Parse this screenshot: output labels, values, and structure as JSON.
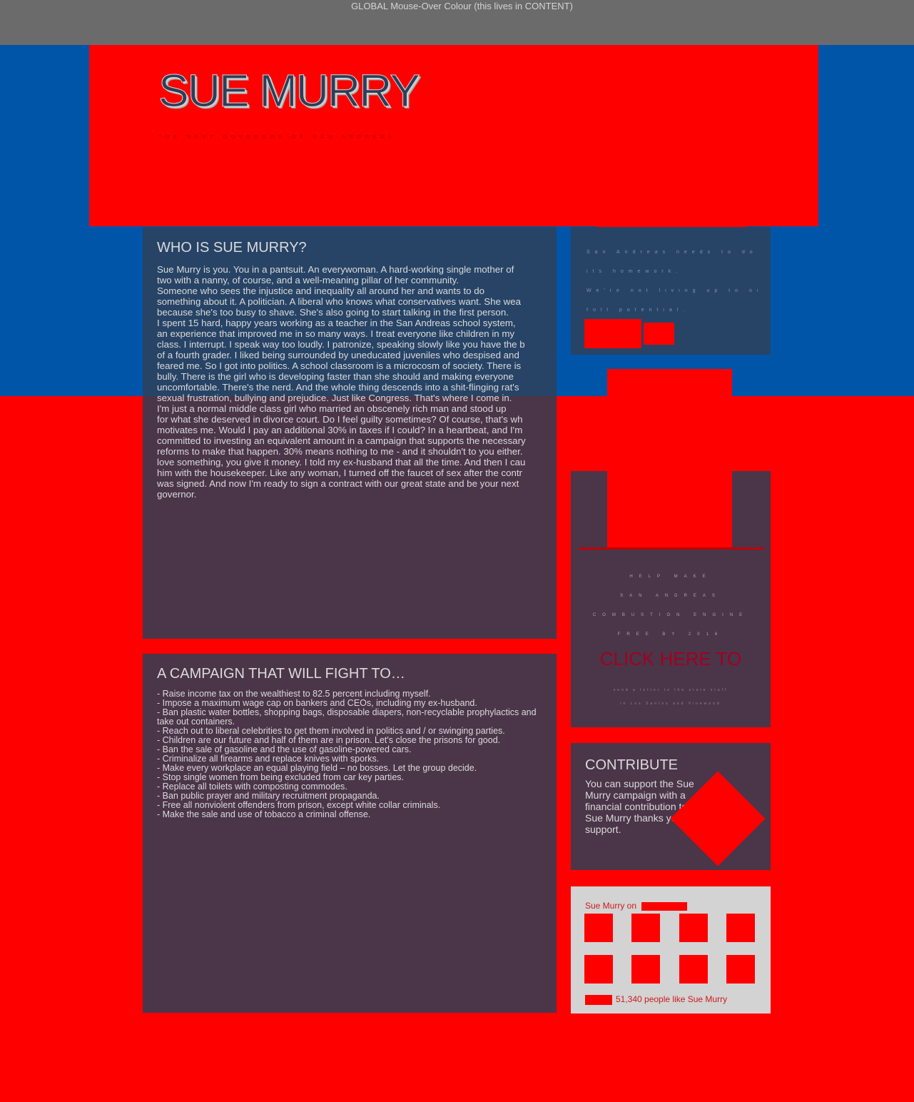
{
  "topbar": {
    "label": "GLOBAL Mouse-Over Colour (this lives in CONTENT)"
  },
  "header": {
    "title": "SUE MURRY",
    "tagline": "THE NEXT GOVERNOR OF SAN ANDREAS"
  },
  "who": {
    "title": "WHO IS SUE MURRY?",
    "lines": [
      "Sue Murry is you. You in a pantsuit. An everywoman. A hard-working single mother of",
      "two with a nanny, of course, and a well-meaning pillar of her community.",
      "Someone who sees the injustice and inequality all around her and wants to do",
      "something about it. A politician. A liberal who knows what conservatives want. She wea",
      "because she's too busy to shave. She's also going to start talking in the first person.",
      "I spent 15 hard, happy years working as a teacher in the San Andreas school system,",
      "an experience that improved me in so many ways. I treat everyone like children in my",
      "class. I interrupt. I speak way too loudly. I patronize, speaking slowly like you have the b",
      "of a fourth grader. I liked being surrounded by uneducated juveniles who despised and",
      "feared me. So I got into politics. A school classroom is a microcosm of society. There is",
      "bully. There is the girl who is developing faster than she should and making everyone",
      "uncomfortable. There's the nerd. And the whole thing descends into a shit-flinging rat's",
      "sexual frustration, bullying and prejudice. Just like Congress. That's where I come in.",
      "I'm just a normal middle class girl who married an obscenely rich man and stood up",
      "for what she deserved in divorce court. Do I feel guilty sometimes? Of course, that's wh",
      "motivates me. Would I pay an additional 30% in taxes if I could? In a heartbeat, and I'm",
      "committed to investing an equivalent amount in a campaign that supports the necessary",
      "reforms to make that happen. 30% means nothing to me - and it shouldn't to you either.",
      "love something, you give it money. I told my ex-husband that all the time. And then I cau",
      "him with the housekeeper. Like any woman, I turned off the faucet of sex after the contr",
      "was signed. And now I'm ready to sign a contract with our great state and be your next",
      "governor."
    ]
  },
  "campaign": {
    "title": "A CAMPAIGN THAT WILL FIGHT TO…",
    "items": [
      "- Raise income tax on the wealthiest to 82.5 percent including myself.",
      "- Impose a maximum wage cap on bankers and CEOs, including my ex-husband.",
      "- Ban plastic water bottles, shopping bags, disposable diapers, non-recyclable prophylactics and take out containers.",
      "- Reach out to liberal celebrities to get them involved in politics and / or swinging parties.",
      "- Children are our future and half of them are in prison. Let's close the prisons for good.",
      "- Ban the sale of gasoline and the use of gasoline-powered cars.",
      "- Criminalize all firearms and replace knives with sporks.",
      "- Make every workplace an equal playing field – no bosses. Let the group decide.",
      "- Stop single women from being excluded from car key parties.",
      "- Replace all toilets with composting commodes.",
      "- Ban public prayer and military recruitment propaganda.",
      "- Free all nonviolent offenders from prison, except white collar criminals.",
      "- Make the sale and use of tobacco a criminal offense."
    ]
  },
  "side1": {
    "lines": [
      "San Andreas needs to do",
      "its homework.",
      "We're not living up to our",
      "full potential."
    ]
  },
  "side2": {
    "lines": [
      "HELP MAKE",
      "SAN ANDREAS",
      "COMBUSTION ENGINE",
      "FREE BY 2016"
    ],
    "cta": "CLICK HERE TO",
    "small_lines": [
      "send a letter to the state staff",
      "in Los Santos and Vinewood"
    ]
  },
  "contribute": {
    "title": "CONTRIBUTE",
    "text": "You can support the Sue Murry campaign with a financial contribution to Sue Murry thanks you for support."
  },
  "social": {
    "label": "Sue Murry on",
    "like_count": "51,340 people like Sue Murry"
  },
  "colors": {
    "page_red": "#ff0000",
    "band_blue": "#0055a8",
    "panel_plum": "#4b3549",
    "panel_blue": "#274466",
    "topbar_gray": "#6b6b6b"
  }
}
